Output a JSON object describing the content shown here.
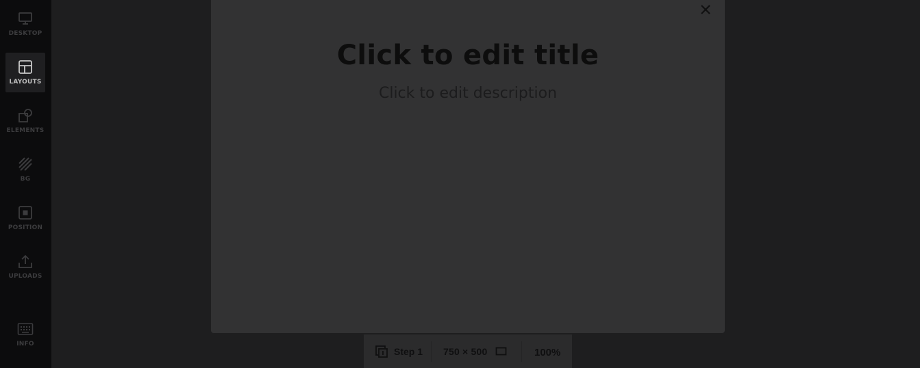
{
  "sidebar": {
    "items": [
      {
        "label": "DESKTOP",
        "icon": "monitor-icon",
        "active": false
      },
      {
        "label": "LAYOUTS",
        "icon": "layout-icon",
        "active": true
      },
      {
        "label": "ELEMENTS",
        "icon": "shapes-icon",
        "active": false
      },
      {
        "label": "BG",
        "icon": "hatch-icon",
        "active": false
      },
      {
        "label": "POSITION",
        "icon": "position-icon",
        "active": false
      },
      {
        "label": "UPLOADS",
        "icon": "upload-icon",
        "active": false
      },
      {
        "label": "INFO",
        "icon": "keyboard-icon",
        "active": false
      }
    ]
  },
  "canvas": {
    "title": "Click to edit title",
    "description": "Click to edit description",
    "close_icon": "close-icon"
  },
  "bottom_bar": {
    "step_label": "Step 1",
    "size_label": "750 × 500",
    "zoom_label": "100%"
  },
  "colors": {
    "sidebar_bg": "#0c0c0d",
    "workspace_bg": "#1e1e1f",
    "canvas_bg": "#323233",
    "active_label": "#bdbdbd"
  }
}
